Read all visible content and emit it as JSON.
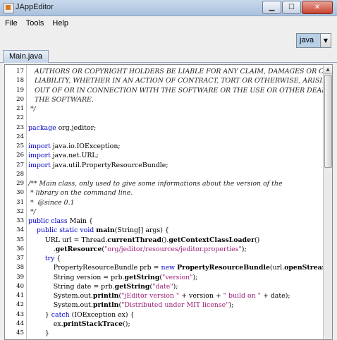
{
  "window": {
    "title": "JAppEditor",
    "icon": "app-icon",
    "controls": [
      "minimize-icon",
      "maximize-icon",
      "close-icon"
    ]
  },
  "menubar": {
    "items": [
      "File",
      "Tools",
      "Help"
    ]
  },
  "toolbar": {
    "language_select": {
      "value": "java",
      "arrow": "▼"
    }
  },
  "tabs": [
    {
      "label": "Main.java",
      "active": true
    }
  ],
  "editor": {
    "lines": [
      {
        "num": "17",
        "tokens": [
          {
            "t": "   AUTHORS OR COPYRIGHT HOLDERS BE LIABLE FOR ANY CLAIM, DAMAGES OR OTHER",
            "c": "comment"
          }
        ]
      },
      {
        "num": "18",
        "tokens": [
          {
            "t": "   LIABILITY, WHETHER IN AN ACTION OF CONTRACT, TORT OR OTHERWISE, ARISING FROM,",
            "c": "comment"
          }
        ]
      },
      {
        "num": "19",
        "tokens": [
          {
            "t": "   OUT OF OR IN CONNECTION WITH THE SOFTWARE OR THE USE OR OTHER DEALINGS IN",
            "c": "comment"
          }
        ]
      },
      {
        "num": "20",
        "tokens": [
          {
            "t": "   THE SOFTWARE.",
            "c": "comment"
          }
        ]
      },
      {
        "num": "21",
        "tokens": [
          {
            "t": " */",
            "c": "comment"
          }
        ]
      },
      {
        "num": "22",
        "tokens": []
      },
      {
        "num": "23",
        "tokens": [
          {
            "t": "package",
            "c": "keyword"
          },
          {
            "t": " org.jeditor;",
            "c": "plain"
          }
        ]
      },
      {
        "num": "24",
        "tokens": []
      },
      {
        "num": "25",
        "tokens": [
          {
            "t": "import",
            "c": "keyword"
          },
          {
            "t": " java.io.IOException;",
            "c": "plain"
          }
        ]
      },
      {
        "num": "26",
        "tokens": [
          {
            "t": "import",
            "c": "keyword"
          },
          {
            "t": " java.net.URL;",
            "c": "plain"
          }
        ]
      },
      {
        "num": "27",
        "tokens": [
          {
            "t": "import",
            "c": "keyword"
          },
          {
            "t": " java.util.PropertyResourceBundle;",
            "c": "plain"
          }
        ]
      },
      {
        "num": "28",
        "tokens": []
      },
      {
        "num": "29",
        "tokens": [
          {
            "t": "/** Main class, only used to give some informations about the version of the",
            "c": "comment"
          }
        ]
      },
      {
        "num": "30",
        "tokens": [
          {
            "t": " * library on the command line.",
            "c": "comment"
          }
        ]
      },
      {
        "num": "31",
        "tokens": [
          {
            "t": " *  @since 0.1",
            "c": "comment"
          }
        ]
      },
      {
        "num": "32",
        "tokens": [
          {
            "t": " */",
            "c": "comment"
          }
        ]
      },
      {
        "num": "33",
        "tokens": [
          {
            "t": "public class",
            "c": "keyword"
          },
          {
            "t": " Main {",
            "c": "plain"
          }
        ]
      },
      {
        "num": "34",
        "tokens": [
          {
            "t": "    ",
            "c": "plain"
          },
          {
            "t": "public static void",
            "c": "keyword"
          },
          {
            "t": " ",
            "c": "plain"
          },
          {
            "t": "main",
            "c": "method"
          },
          {
            "t": "(String[] args) {",
            "c": "plain"
          }
        ]
      },
      {
        "num": "35",
        "tokens": [
          {
            "t": "        URL url = Thread.",
            "c": "plain"
          },
          {
            "t": "currentThread",
            "c": "method"
          },
          {
            "t": "().",
            "c": "plain"
          },
          {
            "t": "getContextClassLoader",
            "c": "method"
          },
          {
            "t": "()",
            "c": "plain"
          }
        ]
      },
      {
        "num": "36",
        "tokens": [
          {
            "t": "            .",
            "c": "plain"
          },
          {
            "t": "getResource",
            "c": "method"
          },
          {
            "t": "(",
            "c": "plain"
          },
          {
            "t": "\"org/jeditor/resources/jeditor.properties\"",
            "c": "string"
          },
          {
            "t": ");",
            "c": "plain"
          }
        ]
      },
      {
        "num": "37",
        "tokens": [
          {
            "t": "        ",
            "c": "plain"
          },
          {
            "t": "try",
            "c": "keyword"
          },
          {
            "t": " {",
            "c": "plain"
          }
        ]
      },
      {
        "num": "38",
        "tokens": [
          {
            "t": "            PropertyResourceBundle prb = ",
            "c": "plain"
          },
          {
            "t": "new",
            "c": "keyword"
          },
          {
            "t": " ",
            "c": "plain"
          },
          {
            "t": "PropertyResourceBundle",
            "c": "method"
          },
          {
            "t": "(url.",
            "c": "plain"
          },
          {
            "t": "openStream",
            "c": "method"
          },
          {
            "t": "());",
            "c": "plain"
          }
        ]
      },
      {
        "num": "39",
        "tokens": [
          {
            "t": "            String version = prb.",
            "c": "plain"
          },
          {
            "t": "getString",
            "c": "method"
          },
          {
            "t": "(",
            "c": "plain"
          },
          {
            "t": "\"version\"",
            "c": "string"
          },
          {
            "t": ");",
            "c": "plain"
          }
        ]
      },
      {
        "num": "40",
        "tokens": [
          {
            "t": "            String date = prb.",
            "c": "plain"
          },
          {
            "t": "getString",
            "c": "method"
          },
          {
            "t": "(",
            "c": "plain"
          },
          {
            "t": "\"date\"",
            "c": "string"
          },
          {
            "t": ");",
            "c": "plain"
          }
        ]
      },
      {
        "num": "41",
        "tokens": [
          {
            "t": "            System.out.",
            "c": "plain"
          },
          {
            "t": "println",
            "c": "method"
          },
          {
            "t": "(",
            "c": "plain"
          },
          {
            "t": "\"jEditor version \"",
            "c": "string"
          },
          {
            "t": " + version + ",
            "c": "plain"
          },
          {
            "t": "\" build on \"",
            "c": "string"
          },
          {
            "t": " + date);",
            "c": "plain"
          }
        ]
      },
      {
        "num": "42",
        "tokens": [
          {
            "t": "            System.out.",
            "c": "plain"
          },
          {
            "t": "println",
            "c": "method"
          },
          {
            "t": "(",
            "c": "plain"
          },
          {
            "t": "\"Distributed under MIT license\"",
            "c": "string"
          },
          {
            "t": ");",
            "c": "plain"
          }
        ]
      },
      {
        "num": "43",
        "tokens": [
          {
            "t": "        } ",
            "c": "plain"
          },
          {
            "t": "catch",
            "c": "keyword"
          },
          {
            "t": " (IOException ex) {",
            "c": "plain"
          }
        ]
      },
      {
        "num": "44",
        "tokens": [
          {
            "t": "            ex.",
            "c": "plain"
          },
          {
            "t": "printStackTrace",
            "c": "method"
          },
          {
            "t": "();",
            "c": "plain"
          }
        ]
      },
      {
        "num": "45",
        "tokens": [
          {
            "t": "        }",
            "c": "plain"
          }
        ]
      }
    ]
  },
  "colors": {
    "keyword": "#0000c8",
    "string": "#9c1f7a",
    "comment": "#222222",
    "titlebar": "#b9cde6"
  }
}
